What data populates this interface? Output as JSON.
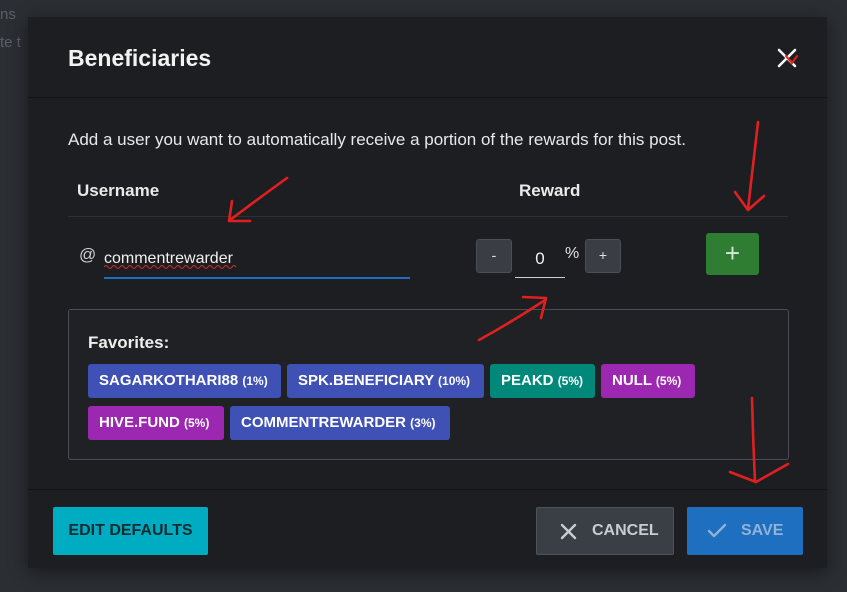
{
  "background": {
    "fragment_1": "ns",
    "fragment_2": "te t"
  },
  "modal": {
    "title": "Beneficiaries",
    "close_icon": "close-icon",
    "description": "Add a user you want to automatically receive a portion of the rewards for this post."
  },
  "table": {
    "username_header": "Username",
    "reward_header": "Reward",
    "at_symbol": "@",
    "username_value": "commentrewarder",
    "decrement_label": "-",
    "reward_value": "0",
    "percent_sign": "%",
    "increment_label": "+",
    "add_label": "+"
  },
  "favorites": {
    "title": "Favorites:",
    "items": [
      {
        "name": "SAGARKOTHARI88",
        "pct": "(1%)",
        "color": "#3f51b5"
      },
      {
        "name": "SPK.BENEFICIARY",
        "pct": "(10%)",
        "color": "#3f51b5"
      },
      {
        "name": "PEAKD",
        "pct": "(5%)",
        "color": "#00897b"
      },
      {
        "name": "NULL",
        "pct": "(5%)",
        "color": "#9c27b0"
      },
      {
        "name": "HIVE.FUND",
        "pct": "(5%)",
        "color": "#9c27b0"
      },
      {
        "name": "COMMENTREWARDER",
        "pct": "(3%)",
        "color": "#3f51b5"
      }
    ]
  },
  "footer": {
    "edit_defaults_label": "EDIT DEFAULTS",
    "cancel_label": "CANCEL",
    "save_label": "SAVE"
  },
  "colors": {
    "modal_bg": "#1d1e21",
    "accent_blue": "#1e6fbf",
    "add_green": "#2f7d32",
    "edit_defaults_cyan": "#00acc1",
    "annotation_red": "#e02020"
  }
}
